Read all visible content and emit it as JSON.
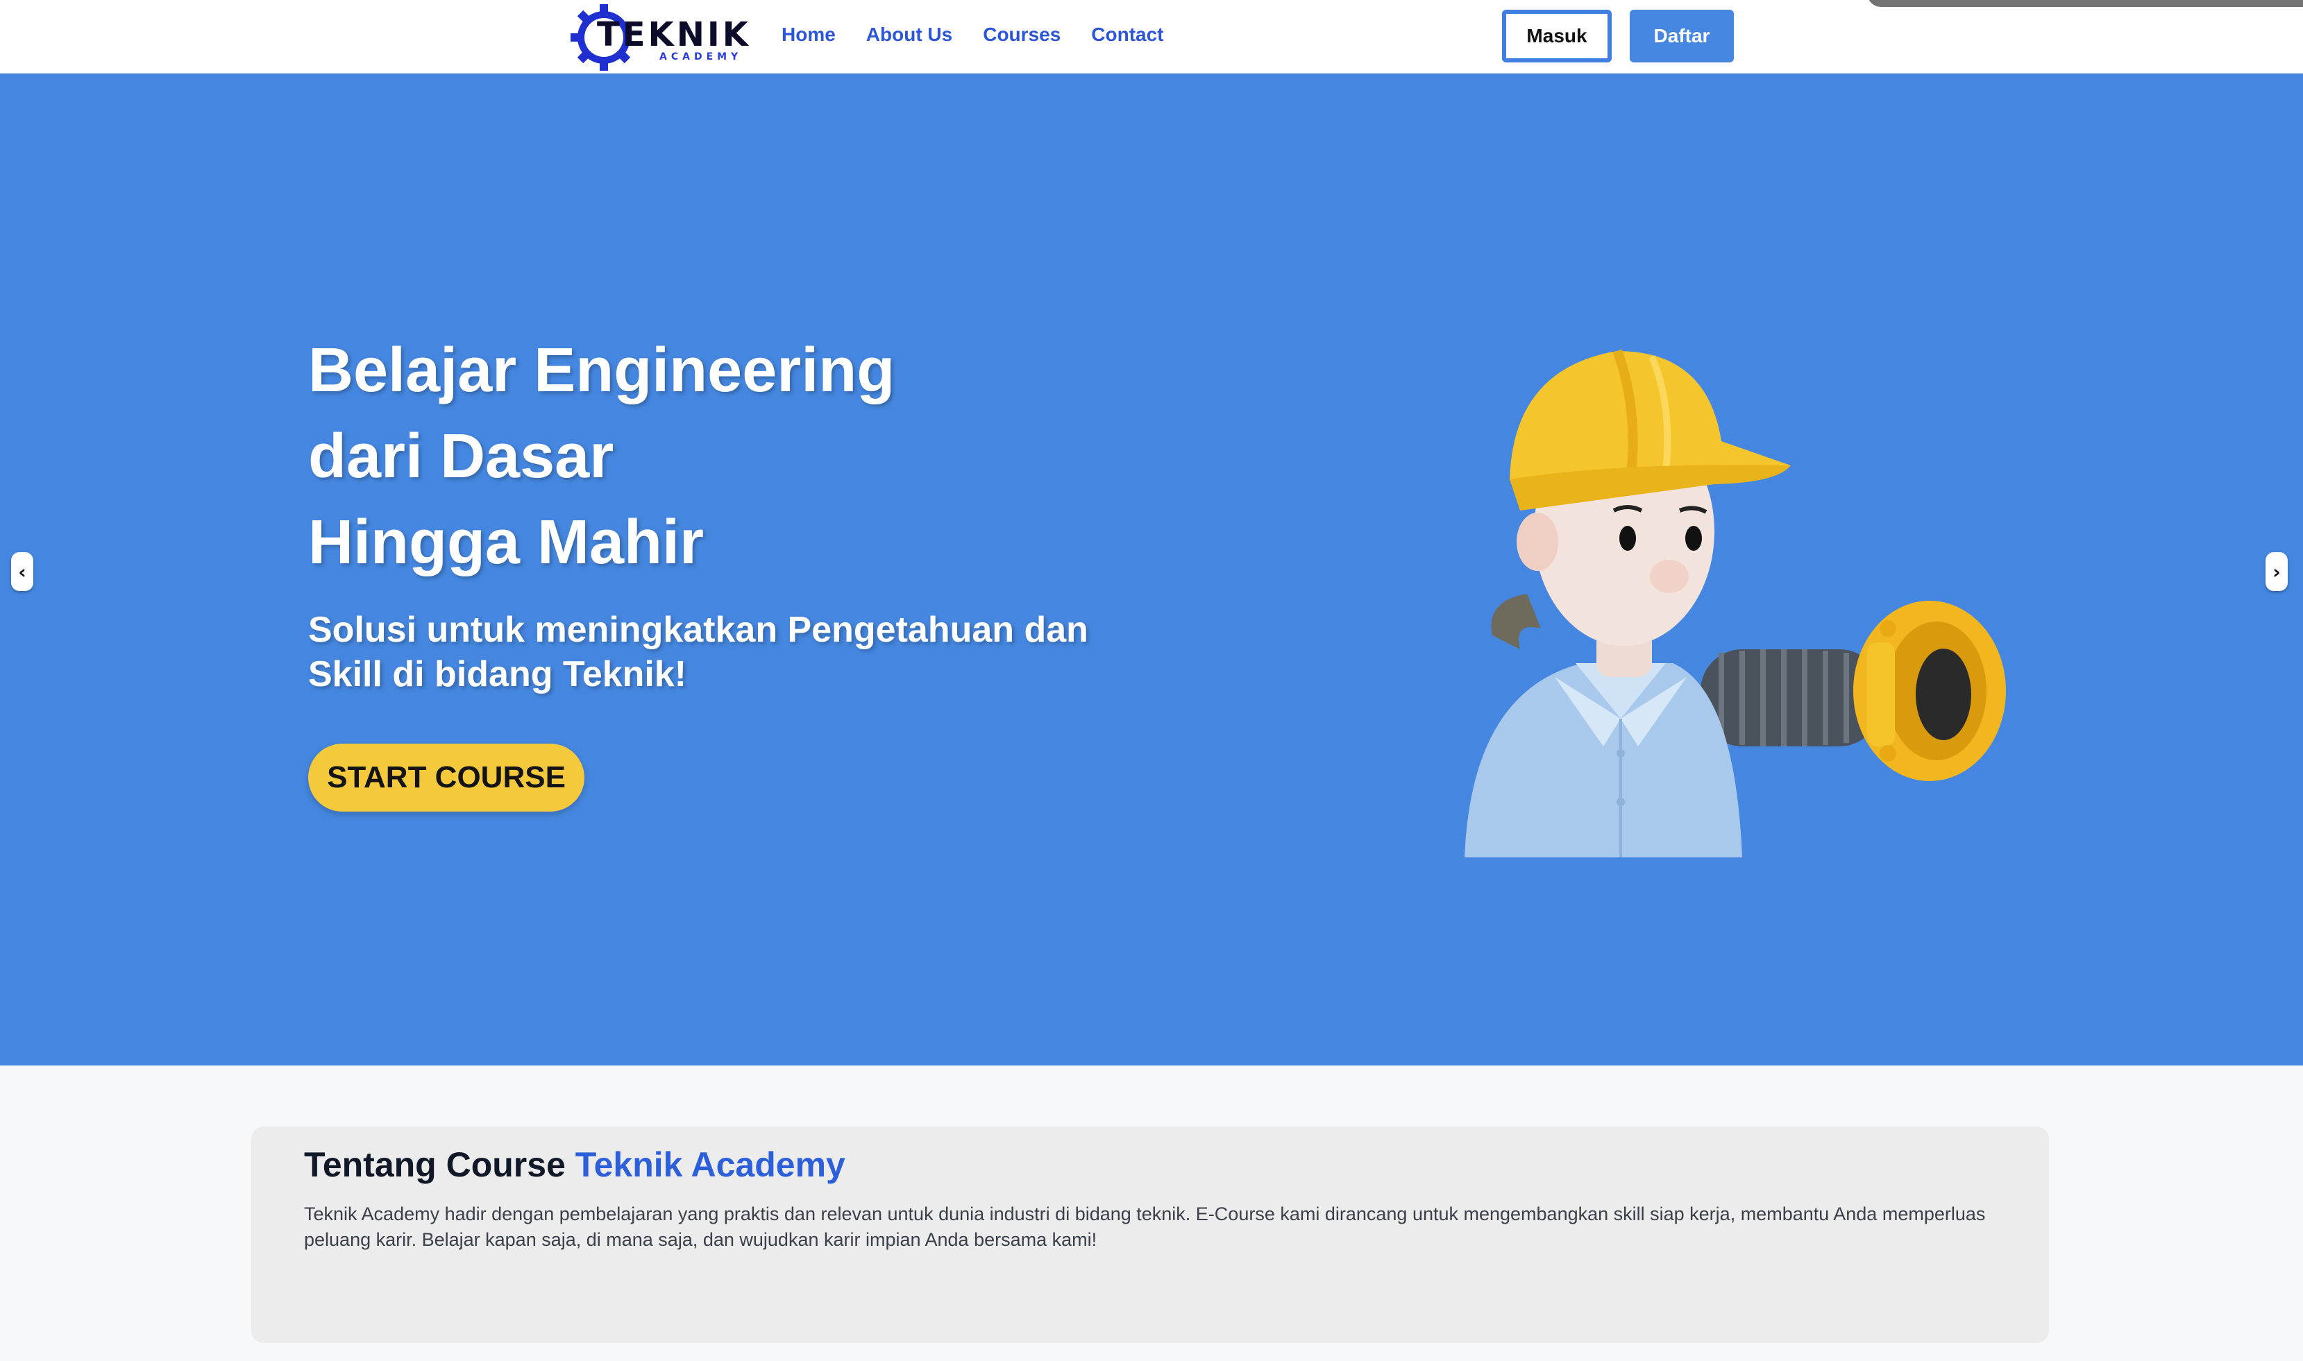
{
  "header": {
    "logo": {
      "word": "TEKNIK",
      "sub": "ACADEMY"
    },
    "nav": [
      "Home",
      "About Us",
      "Courses",
      "Contact"
    ],
    "login_label": "Masuk",
    "register_label": "Daftar"
  },
  "hero": {
    "title_lines": [
      "Belajar Engineering",
      "dari Dasar",
      "Hingga Mahir"
    ],
    "subtitle_lines": [
      "Solusi untuk meningkatkan Pengetahuan dan",
      "Skill di bidang Teknik!"
    ],
    "cta_label": "START COURSE",
    "prev_arrow": "‹",
    "next_arrow": "›"
  },
  "about": {
    "title_plain": "Tentang Course",
    "title_accent": "Teknik Academy",
    "text": "Teknik Academy hadir dengan pembelajaran yang praktis dan relevan untuk dunia industri di bidang teknik. E-Course kami dirancang untuk mengembangkan skill siap kerja, membantu Anda memperluas peluang karir. Belajar kapan saja, di mana saja, dan wujudkan karir impian Anda bersama kami!"
  },
  "colors": {
    "hero_bg": "#4587e0",
    "accent_blue": "#2c56d6",
    "cta_yellow": "#f5c93c",
    "about_card": "#ececec"
  },
  "icons": [
    "gear-logo-icon",
    "chevron-left-icon",
    "chevron-right-icon",
    "engineer-illustration"
  ]
}
